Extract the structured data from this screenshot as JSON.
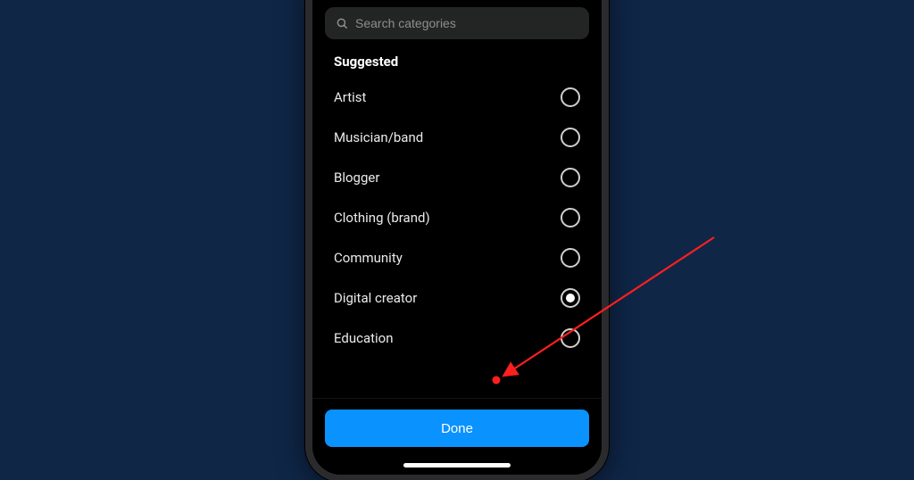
{
  "search": {
    "placeholder": "Search categories"
  },
  "section_header": "Suggested",
  "categories": [
    {
      "label": "Artist",
      "selected": false
    },
    {
      "label": "Musician/band",
      "selected": false
    },
    {
      "label": "Blogger",
      "selected": false
    },
    {
      "label": "Clothing (brand)",
      "selected": false
    },
    {
      "label": "Community",
      "selected": false
    },
    {
      "label": "Digital creator",
      "selected": true
    },
    {
      "label": "Education",
      "selected": false
    }
  ],
  "done_label": "Done",
  "colors": {
    "accent": "#0a92ff",
    "annotation": "#ff1f1f"
  }
}
